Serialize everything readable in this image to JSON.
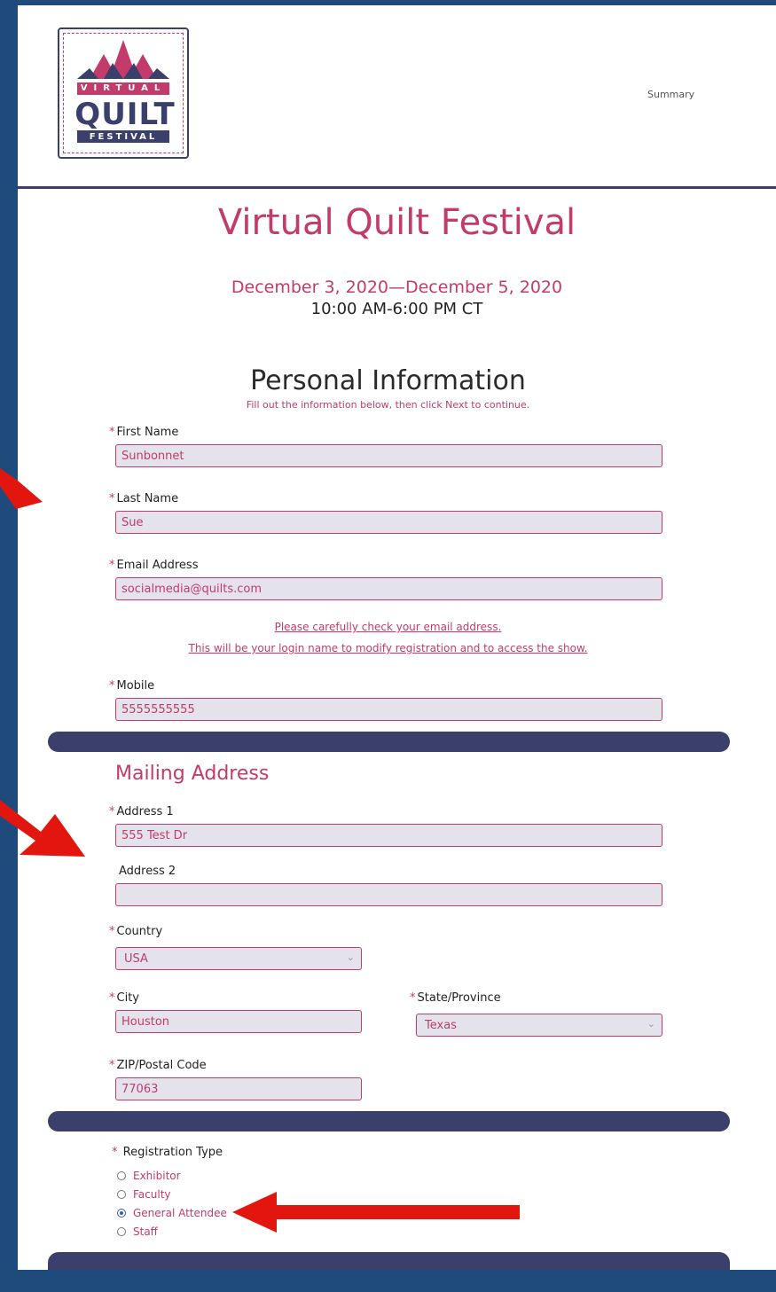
{
  "header": {
    "logo": {
      "line1": "VIRTUAL",
      "line2": "QUILT",
      "line3": "FESTIVAL"
    },
    "summary_link": "Summary"
  },
  "event": {
    "title": "Virtual Quilt Festival",
    "dates": "December 3, 2020—December 5, 2020",
    "times": "10:00 AM-6:00 PM CT"
  },
  "personal": {
    "title": "Personal Information",
    "subtitle": "Fill out the information below, then click Next to continue.",
    "first_name": {
      "label": "First Name",
      "value": "Sunbonnet"
    },
    "last_name": {
      "label": "Last Name",
      "value": "Sue"
    },
    "email": {
      "label": "Email Address",
      "value": "socialmedia@quilts.com"
    },
    "email_note1": "Please carefully check your email address.",
    "email_note2": "This will be your login name to modify registration and to access the show.",
    "mobile": {
      "label": "Mobile",
      "value": "5555555555"
    }
  },
  "mailing": {
    "title": "Mailing Address",
    "address1": {
      "label": "Address 1",
      "value": "555 Test Dr"
    },
    "address2": {
      "label": "Address 2",
      "value": ""
    },
    "country": {
      "label": "Country",
      "value": "USA"
    },
    "city": {
      "label": "City",
      "value": "Houston"
    },
    "state": {
      "label": "State/Province",
      "value": "Texas"
    },
    "zip": {
      "label": "ZIP/Postal Code",
      "value": "77063"
    }
  },
  "registration": {
    "label": "Registration Type",
    "options": [
      "Exhibitor",
      "Faculty",
      "General Attendee",
      "Staff"
    ],
    "selected": "General Attendee"
  },
  "required_mark": "*",
  "colors": {
    "accent": "#c23b6b",
    "navy": "#3a3f6b",
    "frame": "#1f4a7c",
    "arrow": "#e3150f",
    "field_bg": "#e4e2ea"
  }
}
